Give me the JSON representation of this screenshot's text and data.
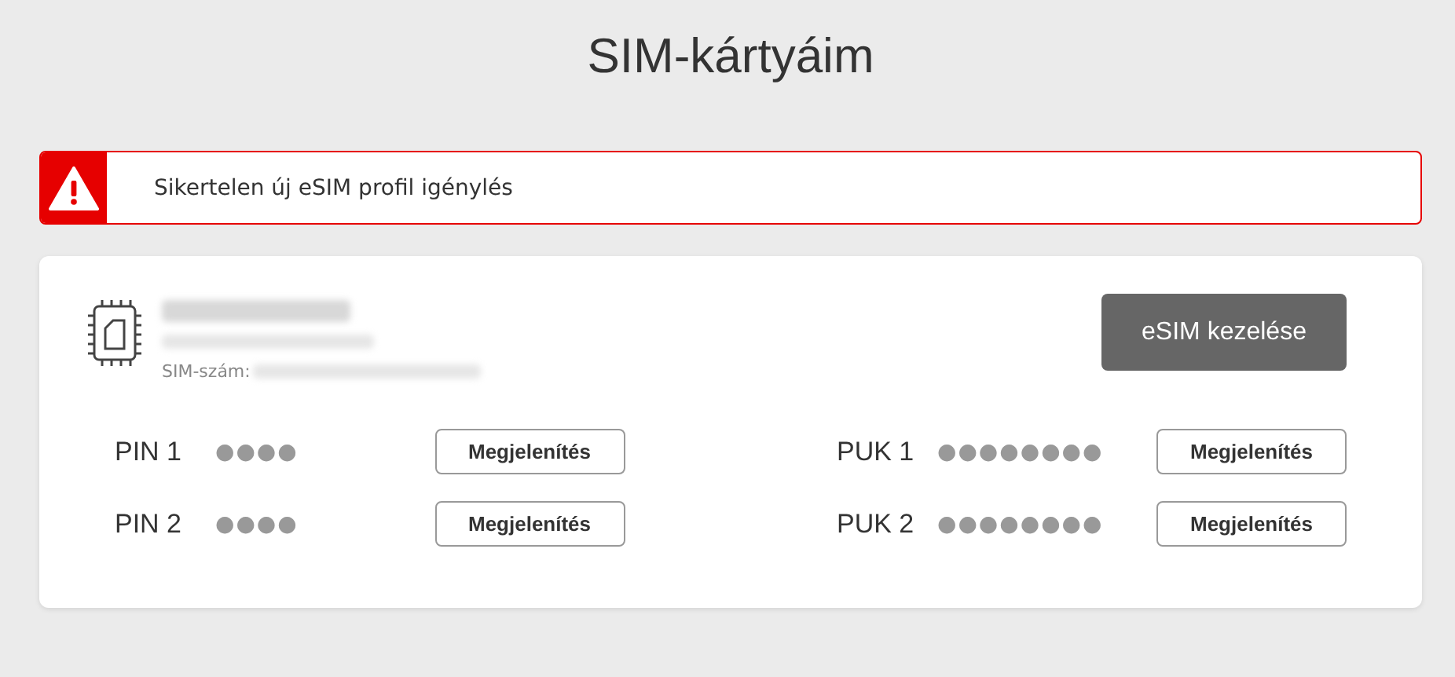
{
  "page_title": "SIM-kártyáim",
  "alert": {
    "message": "Sikertelen új eSIM profil igénylés"
  },
  "sim_card": {
    "sim_number_label": "SIM-szám:",
    "manage_button": "eSIM kezelése",
    "codes": [
      {
        "label": "PIN 1",
        "value": "●●●●",
        "button": "Megjelenítés"
      },
      {
        "label": "PUK 1",
        "value": "●●●●●●●●",
        "button": "Megjelenítés"
      },
      {
        "label": "PIN 2",
        "value": "●●●●",
        "button": "Megjelenítés"
      },
      {
        "label": "PUK 2",
        "value": "●●●●●●●●",
        "button": "Megjelenítés"
      }
    ]
  }
}
